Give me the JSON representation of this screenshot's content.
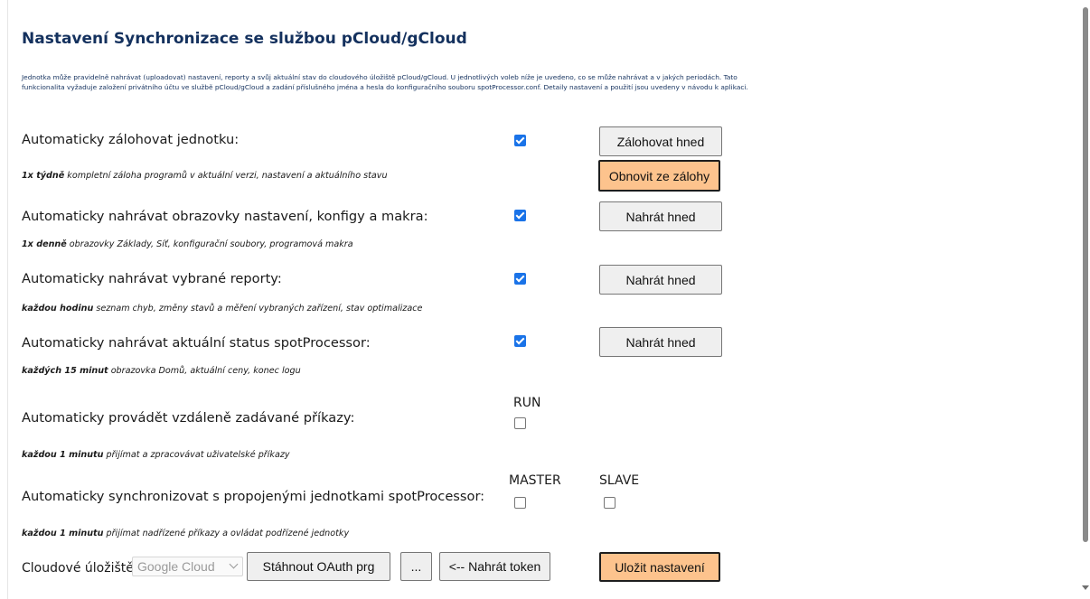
{
  "title": "Nastavení Synchronizace se službou pCloud/gCloud",
  "intro": "Jednotka může pravidelně nahrávat (uploadovat) nastavení, reporty a svůj aktuální stav do cloudového úložiště pCloud/gCloud. U jednotlivých voleb níže je uvedeno, co se může nahrávat a v jakých periodách. Tato funkcionalita vyžaduje založení privátního účtu ve službě pCloud/gCloud a zadání příslušného jména a hesla do konfiguračního souboru spotProcessor.conf. Detaily nastavení a použití jsou uvedeny v návodu k aplikaci.",
  "rows": [
    {
      "label": "Automaticky zálohovat jednotku:",
      "note_bold": "1x týdně",
      "note_text": " kompletní záloha programů v aktuální verzi, nastavení a aktuálního stavu",
      "checked": true,
      "button": "Zálohovat hned"
    },
    {
      "label": "Automaticky nahrávat obrazovky nastavení, konfigy a makra:",
      "note_bold": "1x denně",
      "note_text": " obrazovky Základy, Síť, konfigurační soubory, programová makra",
      "checked": true,
      "button": "Nahrát hned"
    },
    {
      "label": "Automaticky nahrávat vybrané reporty:",
      "note_bold": "každou hodinu",
      "note_text": " seznam chyb, změny stavů a měření vybraných zařízení, stav optimalizace",
      "checked": true,
      "button": "Nahrát hned"
    },
    {
      "label": "Automaticky nahrávat aktuální status spotProcessor:",
      "note_bold": "každých 15 minut",
      "note_text": " obrazovka Domů, aktuální ceny, konec logu",
      "checked": true,
      "button": "Nahrát hned"
    },
    {
      "label": "Automaticky provádět vzdáleně zadávané příkazy:",
      "note_bold": "každou 1 minutu",
      "note_text": " přijímat a zpracovávat uživatelské příkazy",
      "checked": false,
      "col_label": "RUN"
    },
    {
      "label": "Automaticky synchronizovat s propojenými jednotkami spotProcessor:",
      "note_bold": "každou 1 minutu",
      "note_text": " přijímat nadřízené příkazy a ovládat podřízené jednotky",
      "checked": false,
      "col_label": "MASTER",
      "checked2": false,
      "col_label2": "SLAVE"
    }
  ],
  "restore_button": "Obnovit ze zálohy",
  "footer": {
    "storage_label": "Cloudové úložiště:",
    "storage_value": "Google Cloud",
    "download_button": "Stáhnout OAuth prg",
    "browse_button": "...",
    "upload_token_button": "<-- Nahrát token",
    "save_button": "Uložit nastavení"
  },
  "colors": {
    "accent": "#1a73e8",
    "title": "#14315e",
    "orange_button": "#fdc38d"
  },
  "icons": {
    "checkbox_checked": "check-icon",
    "select_arrow": "chevron-down-icon"
  }
}
